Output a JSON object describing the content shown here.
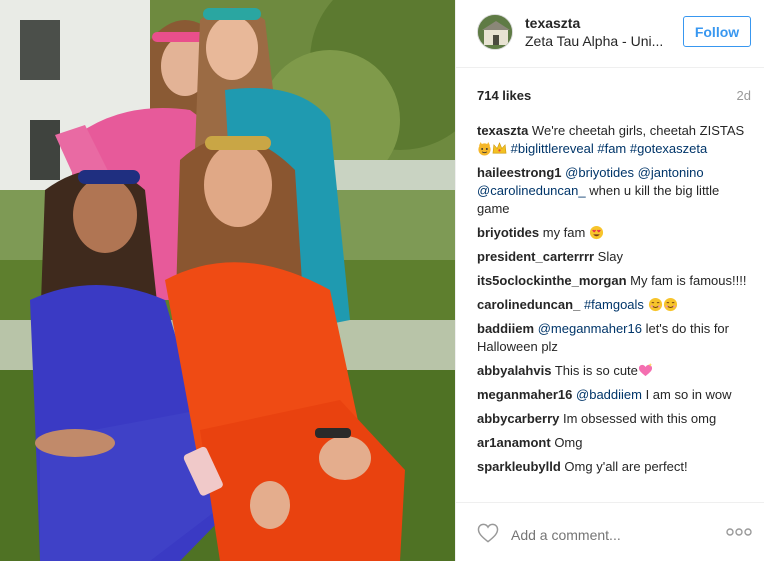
{
  "post": {
    "username": "texaszta",
    "location": "Zeta Tau Alpha - Uni...",
    "follow_label": "Follow",
    "likes": "714 likes",
    "age": "2d",
    "add_comment_placeholder": "Add a comment...",
    "comments": [
      {
        "user": "texaszta",
        "parts": [
          {
            "t": "text",
            "v": " We're cheetah girls, cheetah ZISTAS"
          },
          {
            "t": "emoji",
            "v": "cat-crown-emoji"
          },
          {
            "t": "emoji",
            "v": "crown-emoji"
          },
          {
            "t": "text",
            "v": " "
          },
          {
            "t": "tag",
            "v": "#biglittlereveal"
          },
          {
            "t": "text",
            "v": " "
          },
          {
            "t": "tag",
            "v": "#fam"
          },
          {
            "t": "text",
            "v": " "
          },
          {
            "t": "tag",
            "v": "#gotexaszeta"
          }
        ]
      },
      {
        "user": "haileestrong1",
        "parts": [
          {
            "t": "text",
            "v": " "
          },
          {
            "t": "tag",
            "v": "@briyotides"
          },
          {
            "t": "text",
            "v": " "
          },
          {
            "t": "tag",
            "v": "@jantonino"
          },
          {
            "t": "text",
            "v": " "
          },
          {
            "t": "tag",
            "v": "@carolineduncan_"
          },
          {
            "t": "text",
            "v": " when u kill the big little game"
          }
        ]
      },
      {
        "user": "briyotides",
        "parts": [
          {
            "t": "text",
            "v": " my fam "
          },
          {
            "t": "emoji",
            "v": "heart-eyes-emoji"
          }
        ]
      },
      {
        "user": "president_carterrrr",
        "parts": [
          {
            "t": "text",
            "v": " Slay"
          }
        ]
      },
      {
        "user": "its5oclockinthe_morgan",
        "parts": [
          {
            "t": "text",
            "v": " My fam is famous!!!!"
          }
        ]
      },
      {
        "user": "carolineduncan_",
        "parts": [
          {
            "t": "text",
            "v": " "
          },
          {
            "t": "tag",
            "v": "#famgoals"
          },
          {
            "t": "text",
            "v": " "
          },
          {
            "t": "emoji",
            "v": "smile-emoji"
          },
          {
            "t": "emoji",
            "v": "smile-emoji"
          }
        ]
      },
      {
        "user": "baddiiem",
        "parts": [
          {
            "t": "text",
            "v": " "
          },
          {
            "t": "tag",
            "v": "@meganmaher16"
          },
          {
            "t": "text",
            "v": " let's do this for Halloween plz"
          }
        ]
      },
      {
        "user": "abbyalahvis",
        "parts": [
          {
            "t": "text",
            "v": " This is so cute"
          },
          {
            "t": "emoji",
            "v": "sparkle-heart-emoji"
          }
        ]
      },
      {
        "user": "meganmaher16",
        "parts": [
          {
            "t": "text",
            "v": " "
          },
          {
            "t": "tag",
            "v": "@baddiiem"
          },
          {
            "t": "text",
            "v": " I am so in wow"
          }
        ]
      },
      {
        "user": "abbycarberry",
        "parts": [
          {
            "t": "text",
            "v": " Im obsessed with this omg"
          }
        ]
      },
      {
        "user": "ar1anamont",
        "parts": [
          {
            "t": "text",
            "v": " Omg"
          }
        ]
      },
      {
        "user": "sparkleubylld",
        "parts": [
          {
            "t": "text",
            "v": " Omg y'all are perfect!"
          }
        ]
      }
    ]
  },
  "colors": {
    "follow_blue": "#3897f0",
    "link_blue": "#003569",
    "text": "#262626",
    "muted": "#999999"
  }
}
